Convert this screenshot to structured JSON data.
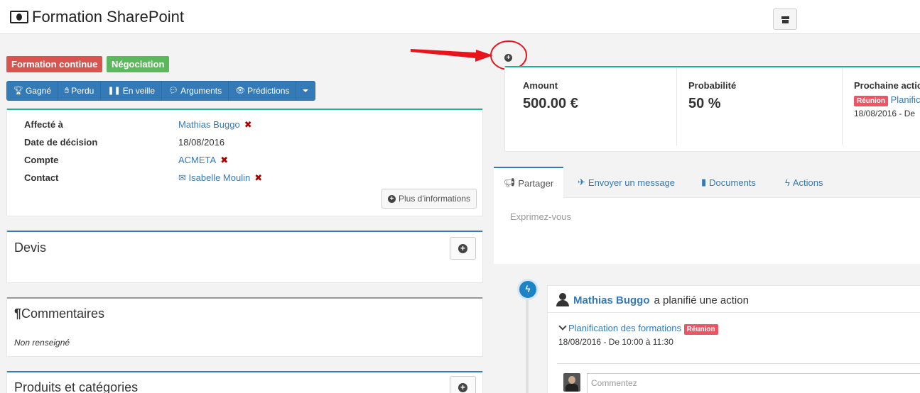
{
  "header": {
    "title": "Formation SharePoint"
  },
  "status_labels": [
    "Formation continue",
    "Négociation"
  ],
  "toolbar": {
    "buttons": [
      "Gagné",
      "Perdu",
      "En veille",
      "Arguments",
      "Prédictions"
    ]
  },
  "details": {
    "assigned_label": "Affecté à",
    "assigned_value": "Mathias Buggo",
    "decision_label": "Date de décision",
    "decision_value": "18/08/2016",
    "account_label": "Compte",
    "account_value": "ACMETA",
    "contact_label": "Contact",
    "contact_value": "Isabelle Moulin",
    "more_info": "Plus d'informations"
  },
  "sections": {
    "quotes": "Devis",
    "comments": "Commentaires",
    "comments_empty": "Non renseigné",
    "products": "Produits et catégories"
  },
  "stats": {
    "amount_label": "Amount",
    "amount_value": "500.00 €",
    "probability_label": "Probabilité",
    "probability_value": "50 %",
    "next_action_label": "Prochaine actio",
    "next_action_badge": "Réunion",
    "next_action_link": "Planific",
    "next_action_date": "18/08/2016 - De"
  },
  "tabs": [
    "Partager",
    "Envoyer un message",
    "Documents",
    "Actions"
  ],
  "share": {
    "placeholder": "Exprimez-vous"
  },
  "timeline": {
    "user": "Mathias Buggo",
    "action_text": "a planifié une action",
    "item_link": "Planification des formations",
    "item_badge": "Réunion",
    "item_date": "18/08/2016 - De 10:00 à 11:30",
    "comment_placeholder": "Commentez"
  },
  "colors": {
    "primary": "#337ab7",
    "danger": "#d9534f",
    "success": "#5cb85c",
    "teal": "#1ab394",
    "annotation_red": "#e8141b"
  }
}
